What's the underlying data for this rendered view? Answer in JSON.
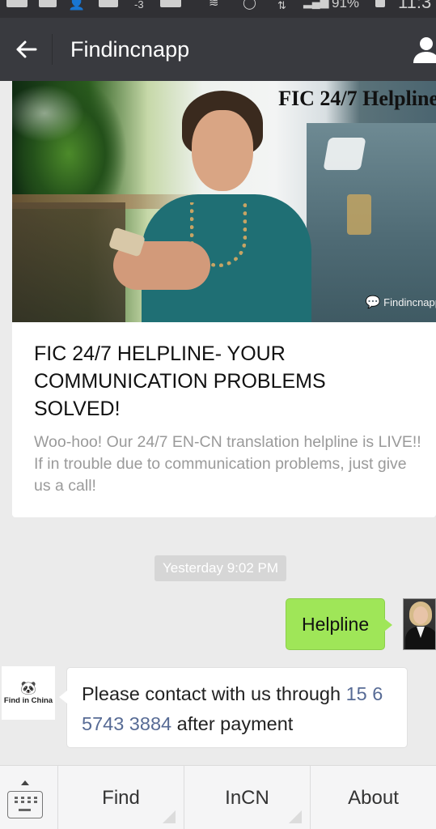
{
  "status_bar": {
    "signal_badge": "-3",
    "battery": "91%",
    "time": "11:3"
  },
  "header": {
    "title": "Findincnapp",
    "back_icon": "arrow-left-icon",
    "profile_icon": "person-icon"
  },
  "article": {
    "cover_title": "FIC 24/7 Helpline",
    "watermark": "Findincnapp",
    "title": "FIC 24/7 HELPLINE- YOUR COMMUNICATION PROBLEMS SOLVED!",
    "description": "Woo-hoo! Our 24/7 EN-CN translation helpline is LIVE!! If in trouble due to communication problems, just give us a call!"
  },
  "messages": {
    "timestamp": "Yesterday 9:02 PM",
    "sent": {
      "text": "Helpline",
      "bubble_color": "#9fe658"
    },
    "received": {
      "sender_brand": "Find in China",
      "text_before": "Please contact with us through ",
      "phone": "15 6 5743 3884",
      "text_after": " after payment",
      "link_color": "#576b95"
    }
  },
  "bottom_menu": {
    "keyboard_icon": "keyboard-icon",
    "items": [
      {
        "label": "Find",
        "has_submenu": true
      },
      {
        "label": "InCN",
        "has_submenu": true
      },
      {
        "label": "About",
        "has_submenu": false
      }
    ]
  },
  "colors": {
    "app_bar": "#393a3f",
    "chat_bg": "#ebebeb"
  }
}
